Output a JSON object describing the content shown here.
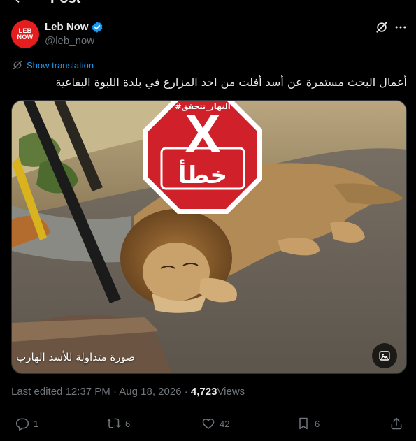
{
  "header": {
    "title": "Post"
  },
  "author": {
    "name": "Leb Now",
    "handle": "@leb_now",
    "avatar_line1": "LEB",
    "avatar_line2": "NOW",
    "avatar_color": "#e41e1e",
    "verified": true
  },
  "translation": {
    "label": "Show translation"
  },
  "tweet": {
    "text": "أعمال البحث مستمرة عن أسد أفلت من احد المزارع في بلدة اللبوة البقاعية"
  },
  "media": {
    "overlay_hashtag": "#النهار_تتحقق",
    "overlay_mark": "X",
    "overlay_verdict": "خطأ",
    "overlay_color": "#d0202a",
    "caption": "صورة متداولة للأسد الهارب"
  },
  "meta": {
    "edited_label": "Last edited",
    "time": "12:37 PM",
    "separator": "·",
    "date": "Aug 18, 2026",
    "views_count": "4,723",
    "views_label": "Views"
  },
  "actions": {
    "replies": "1",
    "reposts": "6",
    "likes": "42",
    "bookmarks": "6"
  },
  "colors": {
    "accent": "#1d9bf0",
    "muted": "#71767b",
    "text": "#e7e9ea",
    "background": "#000000"
  }
}
